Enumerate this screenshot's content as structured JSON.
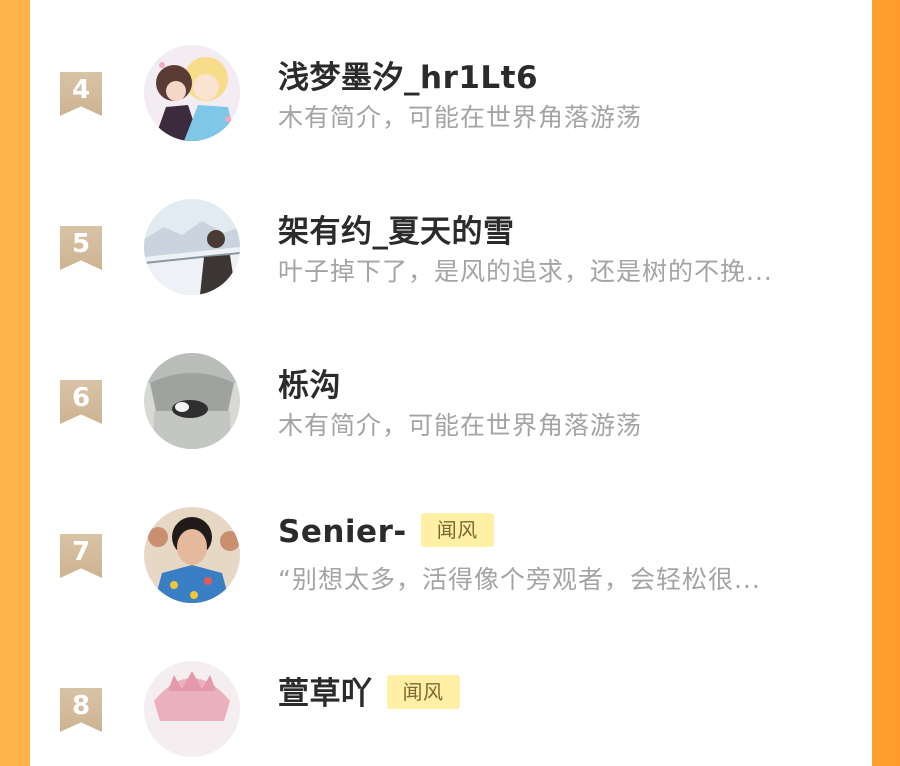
{
  "list": {
    "items": [
      {
        "rank": "4",
        "name": "浅梦墨汐_hr1Lt6",
        "badge": "",
        "desc": "木有简介，可能在世界角落游荡",
        "avatar_icon": "anime-couple-avatar"
      },
      {
        "rank": "5",
        "name": "架有约_夏天的雪",
        "badge": "",
        "desc": "叶子掉下了，是风的追求，还是树的不挽...",
        "avatar_icon": "snow-scene-avatar"
      },
      {
        "rank": "6",
        "name": "栎沟",
        "badge": "",
        "desc": "木有简介，可能在世界角落游荡",
        "avatar_icon": "cat-statue-avatar"
      },
      {
        "rank": "7",
        "name": "Senier-",
        "badge": "闻风",
        "desc": "“别想太多，活得像个旁观者，会轻松很...",
        "avatar_icon": "man-portrait-avatar"
      },
      {
        "rank": "8",
        "name": "萱草吖",
        "badge": "闻风",
        "desc": "",
        "avatar_icon": "anime-pink-hair-avatar"
      }
    ]
  },
  "colors": {
    "background_orange": "#ffa12e",
    "rank_badge": "#d9c3a6",
    "name_text": "#2b2b2b",
    "desc_text": "#a4a4a4",
    "tag_bg": "#fff0a6"
  }
}
